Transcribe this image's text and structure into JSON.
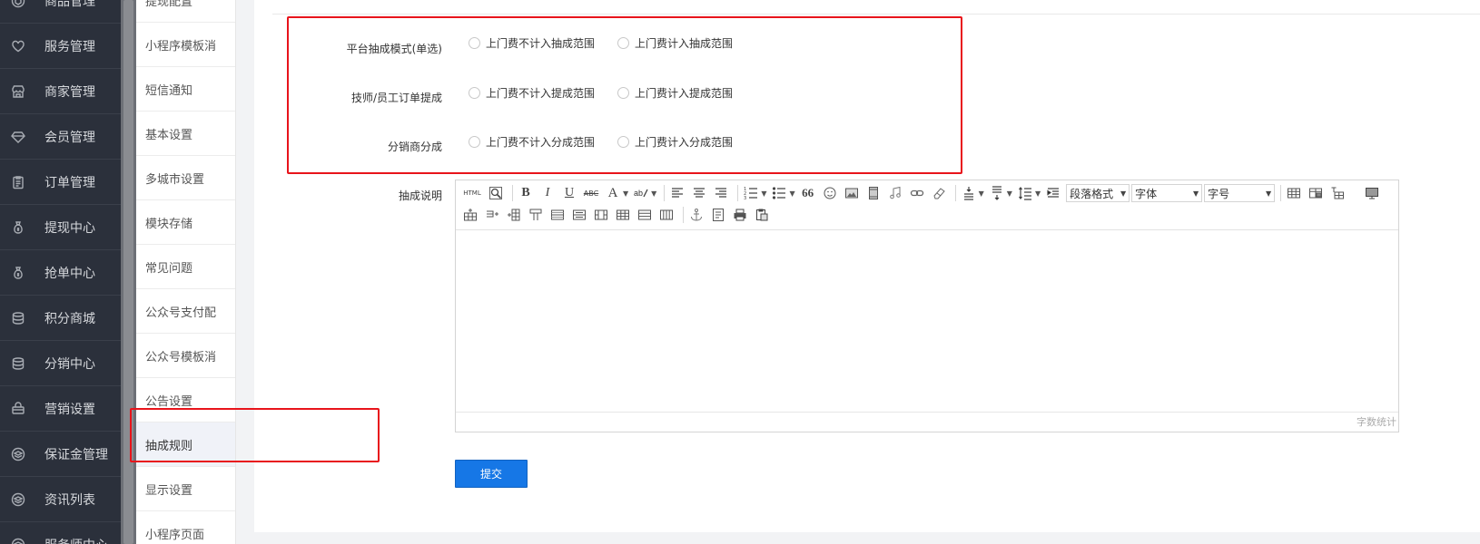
{
  "sidebar": {
    "items": [
      {
        "label": "商品管理",
        "icon": "box-icon"
      },
      {
        "label": "服务管理",
        "icon": "heart-icon"
      },
      {
        "label": "商家管理",
        "icon": "store-icon"
      },
      {
        "label": "会员管理",
        "icon": "diamond-icon"
      },
      {
        "label": "订单管理",
        "icon": "clipboard-icon"
      },
      {
        "label": "提现中心",
        "icon": "money-bag-icon"
      },
      {
        "label": "抢单中心",
        "icon": "money-bag-icon"
      },
      {
        "label": "积分商城",
        "icon": "database-icon"
      },
      {
        "label": "分销中心",
        "icon": "database-icon"
      },
      {
        "label": "营销设置",
        "icon": "basket-icon"
      },
      {
        "label": "保证金管理",
        "icon": "layers-icon"
      },
      {
        "label": "资讯列表",
        "icon": "layers-icon"
      },
      {
        "label": "服务师中心",
        "icon": "layers-icon"
      }
    ]
  },
  "submenu": {
    "items": [
      {
        "label": "提现配置"
      },
      {
        "label": "小程序模板消"
      },
      {
        "label": "短信通知"
      },
      {
        "label": "基本设置"
      },
      {
        "label": "多城市设置"
      },
      {
        "label": "模块存储"
      },
      {
        "label": "常见问题"
      },
      {
        "label": "公众号支付配"
      },
      {
        "label": "公众号模板消"
      },
      {
        "label": "公告设置"
      },
      {
        "label": "抽成规则"
      },
      {
        "label": "显示设置"
      },
      {
        "label": "小程序页面"
      }
    ],
    "active_index": 10
  },
  "form": {
    "rows": [
      {
        "label": "平台抽成模式(单选)",
        "options": [
          "上门费不计入抽成范围",
          "上门费计入抽成范围"
        ]
      },
      {
        "label": "技师/员工订单提成",
        "options": [
          "上门费不计入提成范围",
          "上门费计入提成范围"
        ]
      },
      {
        "label": "分销商分成",
        "options": [
          "上门费不计入分成范围",
          "上门费计入分成范围"
        ]
      }
    ],
    "description_label": "抽成说明",
    "submit_label": "提交"
  },
  "editor": {
    "toolbar": {
      "html_label": "HTML",
      "bold": "B",
      "italic": "I",
      "underline": "U",
      "strike": "ABC",
      "font_color": "A",
      "quote": "66",
      "paragraph_select": "段落格式",
      "font_select": "字体",
      "size_select": "字号"
    },
    "word_count_label": "字数统计",
    "content": ""
  },
  "colors": {
    "sidebar_bg": "#2b303b",
    "accent": "#1677e6",
    "highlight": "#e8141b"
  }
}
